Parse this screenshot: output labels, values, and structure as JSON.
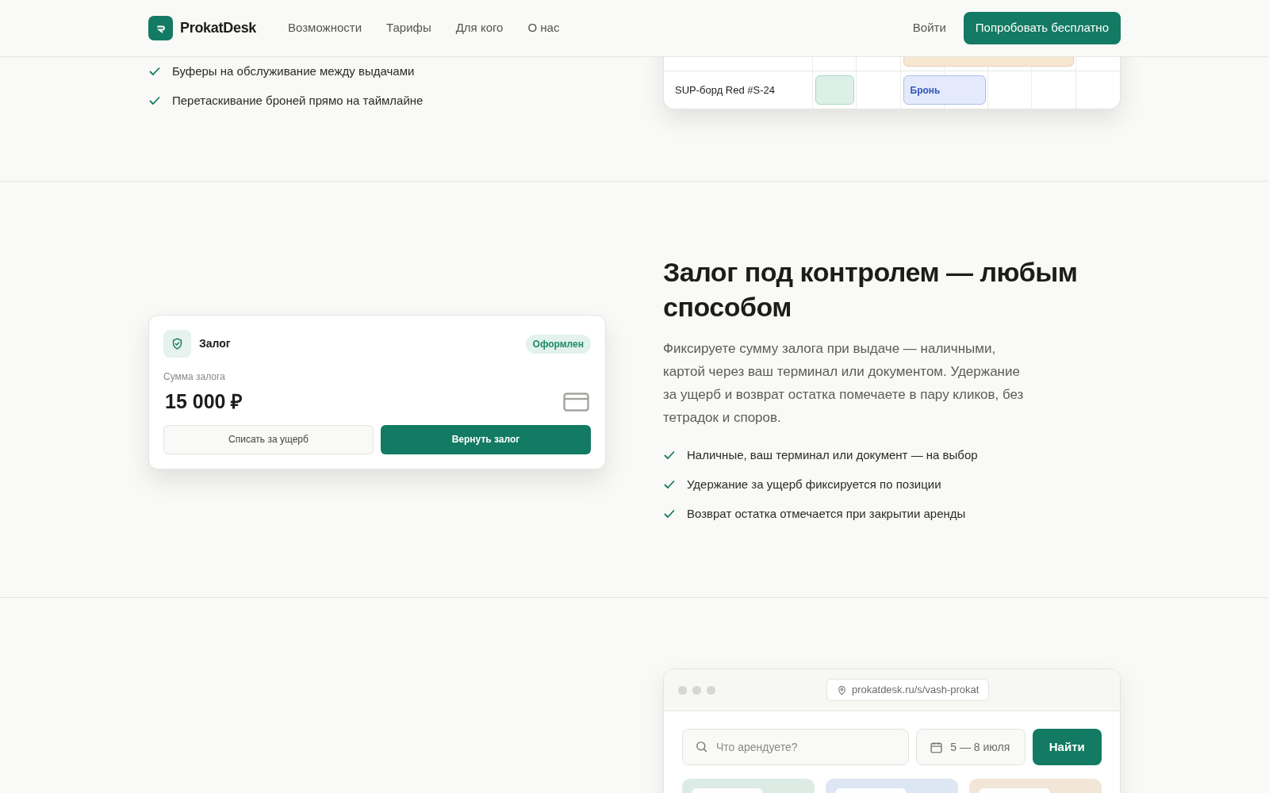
{
  "header": {
    "brand": "ProkatDesk",
    "nav": [
      "Возможности",
      "Тарифы",
      "Для кого",
      "О нас"
    ],
    "login": "Войти",
    "cta": "Попробовать бесплатно"
  },
  "top_section": {
    "checks": [
      "Буферы на обслуживание между выдачами",
      "Перетаскивание броней прямо на таймлайне"
    ],
    "timeline": {
      "rows": [
        {
          "cells": [
            {
              "kind": "gap"
            },
            {
              "kind": "gap"
            },
            {
              "kind": "maintenance"
            },
            {
              "kind": "maintenance"
            },
            {
              "kind": "maintenance"
            },
            {
              "kind": "maintenance"
            },
            {
              "kind": "gap"
            }
          ]
        },
        {
          "label": "SUP-борд Red #S-24",
          "cells": [
            {
              "kind": "free"
            },
            {
              "kind": "gap"
            },
            {
              "kind": "booking",
              "text": "Бронь"
            },
            {
              "kind": "booking"
            },
            {
              "kind": "gap"
            },
            {
              "kind": "gap"
            },
            {
              "kind": "gap"
            }
          ]
        }
      ]
    }
  },
  "deposit_section": {
    "card": {
      "title": "Залог",
      "status": "Оформлен",
      "amount_label": "Сумма залога",
      "amount": "15 000 ₽",
      "secondary_button": "Списать за ущерб",
      "primary_button": "Вернуть залог"
    },
    "heading": "Залог под контролем — любым способом",
    "text": "Фиксируете сумму залога при выдаче — наличными, картой через ваш терминал или документом. Удержание за ущерб и возврат остатка помечаете в пару кликов, без тетрадок и споров.",
    "checks": [
      "Наличные, ваш терминал или документ — на выбор",
      "Удержание за ущерб фиксируется по позиции",
      "Возврат остатка отмечается при закрытии аренды"
    ]
  },
  "storefront_section": {
    "browser": {
      "url": "prokatdesk.ru/s/vash-prokat",
      "search_placeholder": "Что арендуете?",
      "dates": "5 — 8 июля",
      "search_button": "Найти",
      "product_cards": [
        {
          "color": "#dcebe4"
        },
        {
          "color": "#dde6f3"
        },
        {
          "color": "#f1e6d8"
        }
      ]
    }
  }
}
